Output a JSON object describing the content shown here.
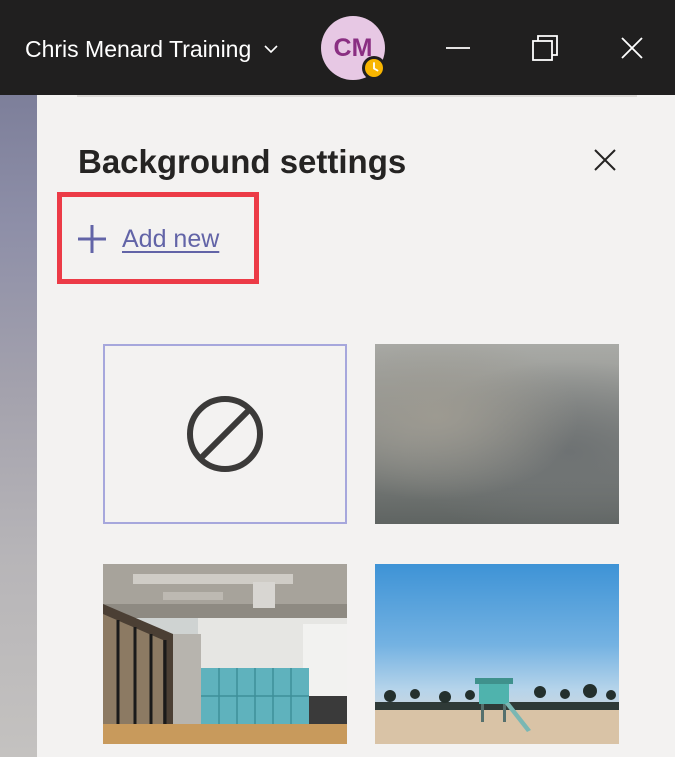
{
  "titlebar": {
    "org_name": "Chris Menard Training",
    "avatar_initials": "CM"
  },
  "panel": {
    "title": "Background settings",
    "add_new_label": "Add new"
  },
  "tiles": [
    {
      "name": "No effect",
      "icon": "no-effect-icon"
    },
    {
      "name": "Blur"
    },
    {
      "name": "Office"
    },
    {
      "name": "Beach"
    }
  ],
  "colors": {
    "titlebar_bg": "#201f1f",
    "panel_bg": "#f3f2f1",
    "accent": "#6264a7",
    "highlight": "#ec3b47",
    "avatar_bg": "#e7c8e4",
    "avatar_text": "#8a2f82",
    "presence_away": "#f8b500"
  }
}
